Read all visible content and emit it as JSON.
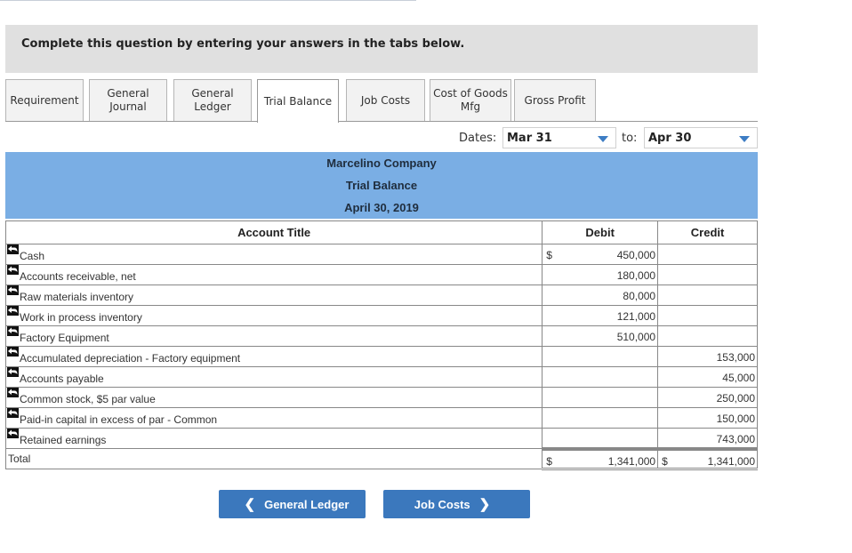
{
  "instruction": "Complete this question by entering your answers in the tabs below.",
  "tabs": [
    {
      "label": "Requirement",
      "active": false
    },
    {
      "label": "General\nJournal",
      "active": false
    },
    {
      "label": "General\nLedger",
      "active": false
    },
    {
      "label": "Trial Balance",
      "active": true
    },
    {
      "label": "Job Costs",
      "active": false
    },
    {
      "label": "Cost of Goods\nMfg",
      "active": false
    },
    {
      "label": "Gross Profit",
      "active": false
    }
  ],
  "dates": {
    "label": "Dates:",
    "from": "Mar 31",
    "to_label": "to:",
    "to": "Apr 30"
  },
  "report_header": {
    "company": "Marcelino Company",
    "title": "Trial Balance",
    "date": "April 30, 2019"
  },
  "table": {
    "columns": {
      "account": "Account Title",
      "debit": "Debit",
      "credit": "Credit"
    },
    "rows": [
      {
        "account": "Cash",
        "debit_sign": "$",
        "debit": "450,000",
        "credit": ""
      },
      {
        "account": "Accounts receivable, net",
        "debit_sign": "",
        "debit": "180,000",
        "credit": ""
      },
      {
        "account": "Raw materials inventory",
        "debit_sign": "",
        "debit": "80,000",
        "credit": ""
      },
      {
        "account": "Work in process inventory",
        "debit_sign": "",
        "debit": "121,000",
        "credit": ""
      },
      {
        "account": "Factory Equipment",
        "debit_sign": "",
        "debit": "510,000",
        "credit": ""
      },
      {
        "account": "Accumulated depreciation - Factory equipment",
        "debit_sign": "",
        "debit": "",
        "credit": "153,000"
      },
      {
        "account": "Accounts payable",
        "debit_sign": "",
        "debit": "",
        "credit": "45,000"
      },
      {
        "account": "Common stock, $5 par value",
        "debit_sign": "",
        "debit": "",
        "credit": "250,000"
      },
      {
        "account": "Paid-in capital in excess of par - Common",
        "debit_sign": "",
        "debit": "",
        "credit": "150,000"
      },
      {
        "account": "Retained earnings",
        "debit_sign": "",
        "debit": "",
        "credit": "743,000"
      }
    ],
    "total": {
      "label": "Total",
      "debit_sign": "$",
      "debit": "1,341,000",
      "credit_sign": "$",
      "credit": "1,341,000"
    }
  },
  "nav": {
    "prev_label": "General Ledger",
    "next_label": "Job Costs"
  },
  "colors": {
    "header_band": "#7aaee4",
    "nav_button": "#3b78bd",
    "instruction_bg": "#e0e0e0"
  }
}
